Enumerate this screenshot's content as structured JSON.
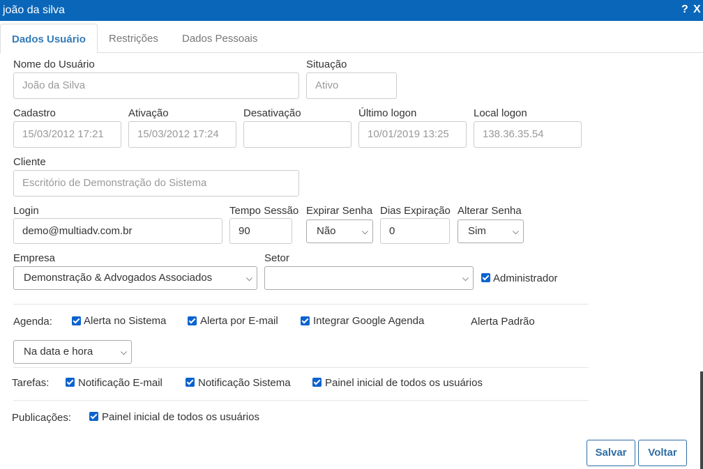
{
  "window": {
    "title": "joão da silva",
    "help": "?",
    "close": "X"
  },
  "tabs": [
    "Dados Usuário",
    "Restrições",
    "Dados Pessoais"
  ],
  "fields": {
    "nome_label": "Nome do Usuário",
    "nome_value": "João da Silva",
    "situacao_label": "Situação",
    "situacao_value": "Ativo",
    "cadastro_label": "Cadastro",
    "cadastro_value": "15/03/2012 17:21",
    "ativacao_label": "Ativação",
    "ativacao_value": "15/03/2012 17:24",
    "desativacao_label": "Desativação",
    "desativacao_value": "",
    "ultimo_logon_label": "Último logon",
    "ultimo_logon_value": "10/01/2019 13:25",
    "local_logon_label": "Local logon",
    "local_logon_value": "138.36.35.54",
    "cliente_label": "Cliente",
    "cliente_value": "Escritório de Demonstração do Sistema",
    "login_label": "Login",
    "login_value": "demo@multiadv.com.br",
    "tempo_label": "Tempo Sessão",
    "tempo_value": "90",
    "expirar_label": "Expirar Senha",
    "expirar_value": "Não",
    "dias_label": "Dias Expiração",
    "dias_value": "0",
    "alterar_label": "Alterar Senha",
    "alterar_value": "Sim",
    "empresa_label": "Empresa",
    "empresa_value": "Demonstração & Advogados Associados",
    "setor_label": "Setor",
    "setor_value": "",
    "administrador_label": "Administrador"
  },
  "agenda": {
    "label": "Agenda:",
    "alerta_sistema": "Alerta no Sistema",
    "alerta_email": "Alerta por E-mail",
    "google": "Integrar Google Agenda",
    "alerta_padrao_label": "Alerta Padrão",
    "alerta_padrao_value": "Na data e hora"
  },
  "tarefas": {
    "label": "Tarefas:",
    "notif_email": "Notificação E-mail",
    "notif_sistema": "Notificação Sistema",
    "painel": "Painel inicial de todos os usuários"
  },
  "publicacoes": {
    "label": "Publicações:",
    "painel": "Painel inicial de todos os usuários"
  },
  "buttons": {
    "salvar": "Salvar",
    "voltar": "Voltar"
  },
  "colors": {
    "titlebar": "#0a66b8",
    "accent": "#337ab7",
    "checkbox": "#0b63ce"
  },
  "icons": {
    "checkbox": "checkbox-checked-icon",
    "select": "chevron-down-icon"
  }
}
